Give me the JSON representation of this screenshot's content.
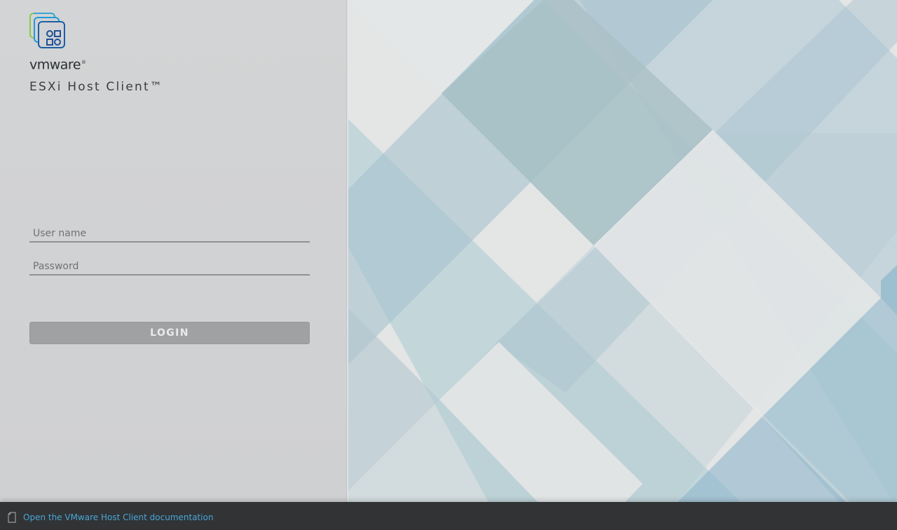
{
  "brand": {
    "wordmark": "vmware",
    "registered": "®",
    "product_title": "ESXi Host Client™",
    "logo_icon": "vmware-host-client-logo-icon"
  },
  "login_form": {
    "username_placeholder": "User name",
    "password_placeholder": "Password",
    "login_label": "LOGIN"
  },
  "footer": {
    "doc_icon": "document-icon",
    "doc_link": "Open the VMware Host Client documentation"
  },
  "colors": {
    "left_panel_bg": "#d3d4d5",
    "login_button_bg": "#a0a1a3",
    "footer_bg": "#313335",
    "link_color": "#49a6d6"
  }
}
